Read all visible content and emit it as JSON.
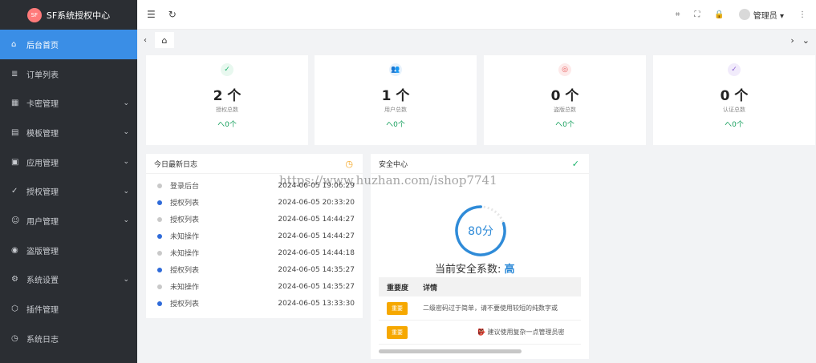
{
  "brand": {
    "logo_text": "SF",
    "title": "SF系统授权中心"
  },
  "sidebar": {
    "items": [
      {
        "icon": "⌂",
        "label": "后台首页",
        "arrow": ""
      },
      {
        "icon": "≣",
        "label": "订单列表",
        "arrow": ""
      },
      {
        "icon": "▦",
        "label": "卡密管理",
        "arrow": "⌄"
      },
      {
        "icon": "▤",
        "label": "模板管理",
        "arrow": "⌄"
      },
      {
        "icon": "▣",
        "label": "应用管理",
        "arrow": "⌄"
      },
      {
        "icon": "✓",
        "label": "授权管理",
        "arrow": "⌄"
      },
      {
        "icon": "☺",
        "label": "用户管理",
        "arrow": "⌄"
      },
      {
        "icon": "◉",
        "label": "盗版管理",
        "arrow": ""
      },
      {
        "icon": "⚙",
        "label": "系统设置",
        "arrow": "⌄"
      },
      {
        "icon": "⬡",
        "label": "插件管理",
        "arrow": ""
      },
      {
        "icon": "◷",
        "label": "系统日志",
        "arrow": ""
      }
    ]
  },
  "topbar": {
    "menu_icon": "☰",
    "refresh_icon": "↻",
    "tag_icon": "⌗",
    "fullscreen_icon": "⛶",
    "lock_icon": "🔒",
    "user": "管理员 ▾",
    "more_icon": "⋮"
  },
  "tabbar": {
    "prev": "‹",
    "home": "⌂",
    "next": "›",
    "dropdown": "⌄"
  },
  "stats": [
    {
      "value": "2 个",
      "label": "授权总数",
      "trend": "へ0个",
      "icon": "✓",
      "color": "#19b36b",
      "bg": "#e8f8ef"
    },
    {
      "value": "1 个",
      "label": "用户总数",
      "trend": "へ0个",
      "icon": "👥",
      "color": "#2f8bd8",
      "bg": "#e7f2fc"
    },
    {
      "value": "0 个",
      "label": "盗版总数",
      "trend": "へ0个",
      "icon": "◎",
      "color": "#e85b5b",
      "bg": "#fdeaea"
    },
    {
      "value": "0 个",
      "label": "认证总数",
      "trend": "へ0个",
      "icon": "✓",
      "color": "#8a63d2",
      "bg": "#f1ebfb"
    }
  ],
  "log": {
    "title": "今日最新日志",
    "icon": "◷",
    "rows": [
      {
        "name": "登录后台",
        "time": "2024-06-05 19:06:29",
        "highlight": false
      },
      {
        "name": "授权列表",
        "time": "2024-06-05 20:33:20",
        "highlight": true
      },
      {
        "name": "授权列表",
        "time": "2024-06-05 14:44:27",
        "highlight": false
      },
      {
        "name": "未知操作",
        "time": "2024-06-05 14:44:27",
        "highlight": true
      },
      {
        "name": "未知操作",
        "time": "2024-06-05 14:44:18",
        "highlight": false
      },
      {
        "name": "授权列表",
        "time": "2024-06-05 14:35:27",
        "highlight": true
      },
      {
        "name": "未知操作",
        "time": "2024-06-05 14:35:27",
        "highlight": false
      },
      {
        "name": "授权列表",
        "time": "2024-06-05 13:33:30",
        "highlight": true
      }
    ]
  },
  "security": {
    "title": "安全中心",
    "icon": "✓",
    "score_text": "80分",
    "score": 80,
    "factor_label": "当前安全系数:",
    "factor_level": "高",
    "col_importance": "重要度",
    "col_detail": "详情",
    "rows": [
      {
        "badge": "重要",
        "detail": "二级密码过于简单，请不要使用较短的纯数字或"
      },
      {
        "badge": "重要",
        "detail": "👺 建议使用复杂一点管理员密"
      }
    ]
  },
  "watermark": "https://www.huzhan.com/ishop7741",
  "colors": {
    "accent": "#3a8ee6",
    "sidebar_bg": "#2b2e33",
    "success": "#19a15f",
    "badge": "#f6a800"
  }
}
